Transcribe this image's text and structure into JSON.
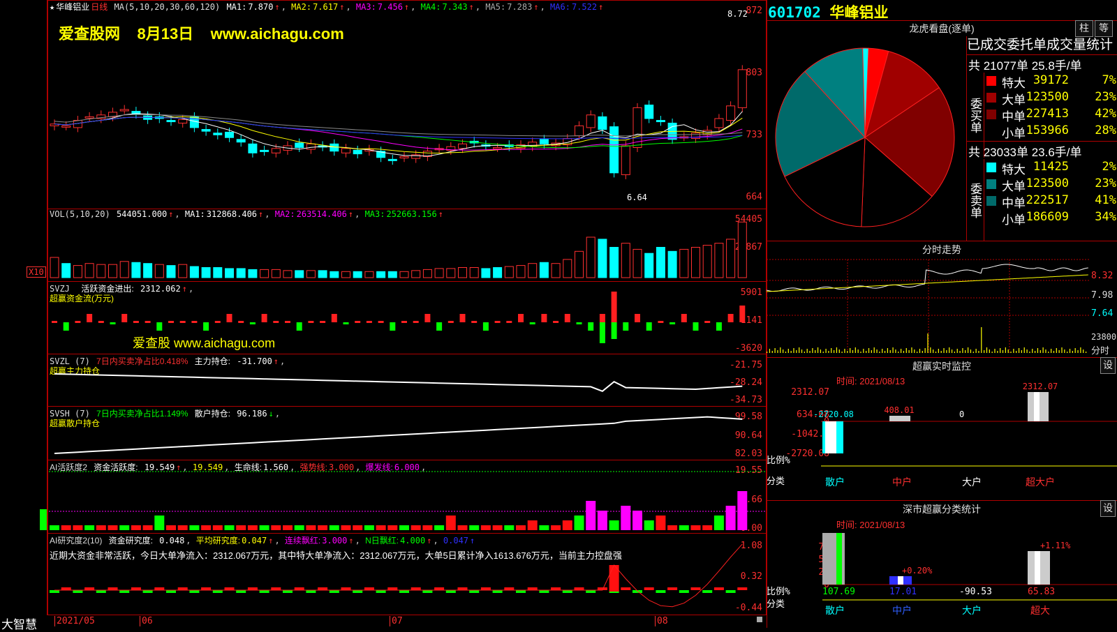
{
  "colors": {
    "up": "#ff3030",
    "down": "#00ffff",
    "grid": "#b00000",
    "ma1": "#ffffff",
    "ma2": "#ffff00",
    "ma3": "#ff00ff",
    "ma4": "#00ff00",
    "ma5": "#888888",
    "ma6": "#3030ff"
  },
  "stock": {
    "code": "601702",
    "name": "华峰铝业"
  },
  "watermark": {
    "site": "爱查股网",
    "date": "8月13日",
    "url": "www.aichagu.com",
    "mid_text": "爱查股 www.aichagu.com"
  },
  "price_panel": {
    "title_star": "★",
    "title_name": "华峰铝业",
    "title_period": "日线",
    "ma_spec": "MA(5,10,20,30,60,120)",
    "ma": [
      {
        "label": "MA1:",
        "value": "7.870",
        "arrow": "↑"
      },
      {
        "label": "MA2:",
        "value": "7.617",
        "arrow": "↑"
      },
      {
        "label": "MA3:",
        "value": "7.456",
        "arrow": "↑"
      },
      {
        "label": "MA4:",
        "value": "7.343",
        "arrow": "↑"
      },
      {
        "label": "MA5:",
        "value": "7.283",
        "arrow": "↑"
      },
      {
        "label": "MA6:",
        "value": "7.522",
        "arrow": "↑"
      }
    ],
    "yticks": [
      "872",
      "803",
      "733",
      "664"
    ],
    "high_label": "8.72",
    "low_label": "6.64"
  },
  "vol_panel": {
    "header": "VOL(5,10,20)",
    "value": "544051.000",
    "ma1": "312868.406",
    "ma2": "263514.406",
    "ma3": "252663.156",
    "ma1_label": "MA1:",
    "ma2_label": "MA2:",
    "ma3_label": "MA3:",
    "yticks": [
      "54405",
      "26867"
    ],
    "unit": "X10"
  },
  "svzj_panel": {
    "name": "SVZJ",
    "label": "活跃资金进出:",
    "value": "2312.062",
    "subtitle": "超赢资金流(万元)",
    "yticks": [
      "5901",
      "1141",
      "-3620"
    ]
  },
  "svzl_panel": {
    "name": "SVZL (7)",
    "desc": "7日内买卖净占比0.418%",
    "label": "主力持仓:",
    "value": "-31.700",
    "subtitle": "超赢主力持仓",
    "yticks": [
      "-21.75",
      "-28.24",
      "-34.73"
    ]
  },
  "svsh_panel": {
    "name": "SVSH (7)",
    "desc": "7日内买卖净占比1.149%",
    "label": "散户持仓:",
    "value": "96.186",
    "subtitle": "超赢散户持仓",
    "yticks": [
      "99.58",
      "90.64",
      "82.03"
    ]
  },
  "ai_active_panel": {
    "name": "AI活跃度2",
    "label": "资金活跃度:",
    "value1": "19.549",
    "value2": "19.549",
    "life_label": "生命线:",
    "life": "1.560",
    "strong_label": "强势线:",
    "strong": "3.000",
    "burst_label": "爆发线:",
    "burst": "6.000",
    "yticks": [
      "19.55",
      "9.66",
      "0.00"
    ]
  },
  "ai_research_panel": {
    "name": "AI研究度2(10)",
    "label": "资金研究度:",
    "value": "0.048",
    "avg_label": "平均研究度:",
    "avg": "0.047",
    "red_label": "连续飘红:",
    "red": "3.000",
    "nred_label": "N日飘红:",
    "nred": "4.000",
    "last": "0.047",
    "commentary": "近期大资金非常活跃，今日大单净流入：2312.067万元，其中特大单净流入：2312.067万元，大单5日累计净入1613.676万元，当前主力控盘强",
    "yticks": [
      "1.08",
      "0.32",
      "-0.44"
    ]
  },
  "date_axis": {
    "brand": "大智慧",
    "labels": [
      "2021/05",
      "06",
      "07",
      "08"
    ]
  },
  "lhb": {
    "title": "龙虎看盘(逐单)",
    "btn1": "柱",
    "btn2": "等",
    "table_title": "已成交委托单成交量统计",
    "buy": {
      "side_label": "委买单",
      "summary": "共 21077单 25.8手/单",
      "rows": [
        {
          "name": "特大",
          "value": "39172",
          "pct": "7%",
          "color": "#ff0000"
        },
        {
          "name": "大单",
          "value": "123500",
          "pct": "23%",
          "color": "#a00000"
        },
        {
          "name": "中单",
          "value": "227413",
          "pct": "42%",
          "color": "#800000"
        },
        {
          "name": "小单",
          "value": "153966",
          "pct": "28%",
          "color": "#000000"
        }
      ]
    },
    "sell": {
      "side_label": "委卖单",
      "summary": "共 23033单 23.6手/单",
      "rows": [
        {
          "name": "特大",
          "value": "11425",
          "pct": "2%",
          "color": "#00ffff"
        },
        {
          "name": "大单",
          "value": "123500",
          "pct": "23%",
          "color": "#008080"
        },
        {
          "name": "中单",
          "value": "222517",
          "pct": "41%",
          "color": "#006a6a"
        },
        {
          "name": "小单",
          "value": "186609",
          "pct": "34%",
          "color": "#000000"
        }
      ]
    }
  },
  "intraday": {
    "title": "分时走势",
    "yticks": [
      "8.32",
      "7.98",
      "7.64"
    ],
    "vol_tick": "23800",
    "unit": "分时"
  },
  "monitor": {
    "title": "超赢实时监控",
    "btn": "设",
    "time": "时间: 2021/08/13",
    "yticks": [
      "2312.07",
      "634.68",
      "0",
      "-1042.7",
      "-2720.08"
    ],
    "ratio_label": "比例%",
    "cat_label": "分类",
    "bars": [
      {
        "cat": "散户",
        "label": "-2720.08"
      },
      {
        "cat": "中户",
        "label": "408.01"
      },
      {
        "cat": "大户",
        "label": "0"
      },
      {
        "cat": "超大户",
        "label": "2312.07"
      }
    ]
  },
  "shenzhen": {
    "title": "深市超赢分类统计",
    "btn": "设",
    "time": "时间: 2021/08/13",
    "yticks": [
      "75",
      "50",
      "25",
      "0"
    ],
    "ratio_label": "比例%",
    "cat_label": "分类",
    "bars": [
      {
        "cat": "散户",
        "top": "",
        "bottom": "107.69"
      },
      {
        "cat": "中户",
        "top": "+0.20%",
        "bottom": "17.01"
      },
      {
        "cat": "大户",
        "top": "",
        "bottom": "-90.53"
      },
      {
        "cat": "超大",
        "top": "+1.11%",
        "bottom": "65.83"
      }
    ]
  }
}
